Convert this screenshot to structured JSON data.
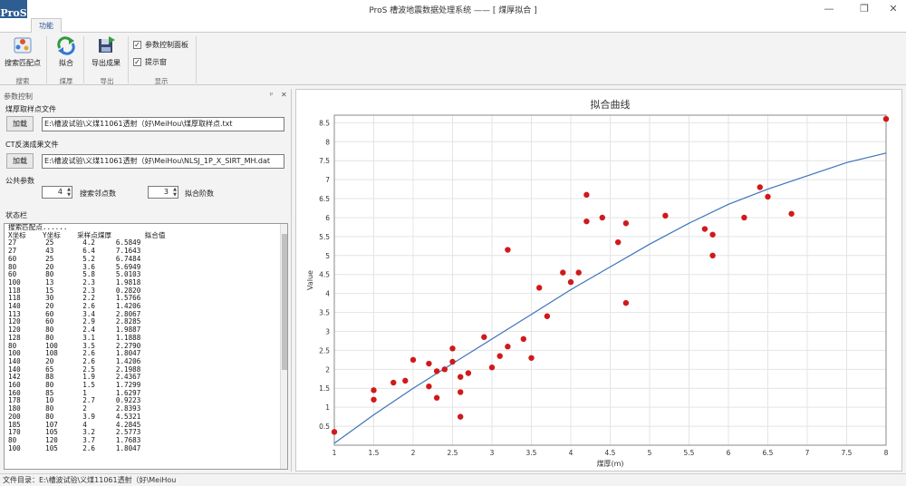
{
  "window": {
    "title": "ProS 槽波地震数据处理系统 —— [ 煤厚拟合 ]",
    "logo": "ProS",
    "controls": [
      "—",
      "❐",
      "✕"
    ]
  },
  "tabs": [
    {
      "label": "功能"
    }
  ],
  "ribbon": {
    "buttons": [
      {
        "label": "搜索匹配点",
        "icon": "search-match-icon"
      },
      {
        "label": "拟合",
        "icon": "fit-icon"
      },
      {
        "label": "导出成果",
        "icon": "export-icon"
      }
    ],
    "checkboxes": [
      {
        "label": "参数控制面板",
        "checked": true
      },
      {
        "label": "提示窗",
        "checked": true
      }
    ],
    "groups": [
      "搜索",
      "煤厚",
      "导出",
      "显示"
    ]
  },
  "panel": {
    "title": "参数控制",
    "pin": "ᵖ",
    "close": "✕",
    "sample_file_label": "煤厚取样点文件",
    "load_label": "加载",
    "sample_file_path": "E:\\槽波试验\\义煤11061透射（好\\MeiHou\\煤厚取样点.txt",
    "ct_file_label": "CT反演成果文件",
    "ct_file_path": "E:\\槽波试验\\义煤11061透射（好\\MeiHou\\NLSJ_1P_X_SIRT_MH.dat",
    "common_params_label": "公共参数",
    "search_count_value": "4",
    "search_count_label": "搜索邻点数",
    "fit_order_value": "3",
    "fit_order_label": "拟合阶数",
    "status_title": "状态栏",
    "status_lines": [
      "搜索匹配点......",
      "X坐标    Y坐标    采样点煤厚        拟合值",
      "27       25       4.2     6.5849",
      "27       43       6.4     7.1643",
      "60       25       5.2     6.7484",
      "80       20       3.6     5.6949",
      "60       80       5.8     5.0103",
      "100      13       2.3     1.9818",
      "118      15       2.3     0.2820",
      "118      30       2.2     1.5766",
      "140      20       2.6     1.4206",
      "113      60       3.4     2.8067",
      "120      60       2.9     2.8285",
      "120      80       2.4     1.9887",
      "128      80       3.1     1.1888",
      "80       100      3.5     2.2790",
      "100      108      2.6     1.8047",
      "140      20       2.6     1.4206",
      "140      65       2.5     2.1988",
      "142      88       1.9     2.4367",
      "160      80       1.5     1.7299",
      "160      85       1       1.6297",
      "178      10       2.7     0.9223",
      "180      80       2       2.8393",
      "200      80       3.9     4.5321",
      "185      107      4       4.2845",
      "170      105      3.2     2.5773",
      "80       120      3.7     1.7683",
      "100      105      2.6     1.8047"
    ]
  },
  "footer": {
    "path_text": "文件目录：E:\\槽波试验\\义煤11061透射（好\\MeiHou"
  },
  "colors": {
    "point": "#d0191b",
    "curve": "#3b74b8",
    "grid": "#e4e4e4",
    "logo_bg": "#2e5d92"
  },
  "chart_data": {
    "type": "scatter",
    "title": "拟合曲线",
    "xlabel": "煤厚(m)",
    "ylabel": "Value",
    "xlim": [
      1,
      8
    ],
    "ylim": [
      0,
      8.7
    ],
    "xticks": [
      1,
      1.5,
      2,
      2.5,
      3,
      3.5,
      4,
      4.5,
      5,
      5.5,
      6,
      6.5,
      7,
      7.5,
      8
    ],
    "xtick_labels": [
      "1",
      "1.5",
      "2",
      "2.5",
      "3",
      "3.5",
      "4",
      "4.5",
      "5",
      "5.5",
      "6",
      "6.5",
      "7",
      "7.5",
      "8"
    ],
    "yticks": [
      0.5,
      1,
      1.5,
      2,
      2.5,
      3,
      3.5,
      4,
      4.5,
      5,
      5.5,
      6,
      6.5,
      7,
      7.5,
      8,
      8.5
    ],
    "ytick_labels": [
      "0.5",
      "1",
      "1.5",
      "2",
      "2.5",
      "3",
      "3.5",
      "4",
      "4.5",
      "5",
      "5.5",
      "6",
      "6.5",
      "7",
      "7.5",
      "8",
      "8.5"
    ],
    "grid": true,
    "series": [
      {
        "type": "scatter",
        "points": [
          [
            1.0,
            0.35
          ],
          [
            1.5,
            1.45
          ],
          [
            1.5,
            1.2
          ],
          [
            1.75,
            1.65
          ],
          [
            1.9,
            1.7
          ],
          [
            2.0,
            2.25
          ],
          [
            2.2,
            2.15
          ],
          [
            2.2,
            1.55
          ],
          [
            2.3,
            1.95
          ],
          [
            2.3,
            1.25
          ],
          [
            2.4,
            2.0
          ],
          [
            2.5,
            2.55
          ],
          [
            2.5,
            2.2
          ],
          [
            2.6,
            1.8
          ],
          [
            2.6,
            1.4
          ],
          [
            2.6,
            0.75
          ],
          [
            2.7,
            1.9
          ],
          [
            2.9,
            2.85
          ],
          [
            3.0,
            2.05
          ],
          [
            3.1,
            2.35
          ],
          [
            3.2,
            2.6
          ],
          [
            3.2,
            5.15
          ],
          [
            3.4,
            2.8
          ],
          [
            3.5,
            2.3
          ],
          [
            3.6,
            4.15
          ],
          [
            3.7,
            3.4
          ],
          [
            3.9,
            4.55
          ],
          [
            4.0,
            4.3
          ],
          [
            4.1,
            4.55
          ],
          [
            4.2,
            6.6
          ],
          [
            4.2,
            5.9
          ],
          [
            4.4,
            6.0
          ],
          [
            4.6,
            5.35
          ],
          [
            4.7,
            5.85
          ],
          [
            4.7,
            3.75
          ],
          [
            5.2,
            6.05
          ],
          [
            5.7,
            5.7
          ],
          [
            5.8,
            5.55
          ],
          [
            5.8,
            5.0
          ],
          [
            6.2,
            6.0
          ],
          [
            6.4,
            6.8
          ],
          [
            6.5,
            6.55
          ],
          [
            6.8,
            6.1
          ],
          [
            8.0,
            8.6
          ]
        ]
      },
      {
        "type": "line",
        "points": [
          [
            1.0,
            0.05
          ],
          [
            1.5,
            0.8
          ],
          [
            2.0,
            1.5
          ],
          [
            2.5,
            2.15
          ],
          [
            3.0,
            2.8
          ],
          [
            3.5,
            3.45
          ],
          [
            4.0,
            4.1
          ],
          [
            4.5,
            4.7
          ],
          [
            5.0,
            5.3
          ],
          [
            5.5,
            5.85
          ],
          [
            6.0,
            6.35
          ],
          [
            6.5,
            6.75
          ],
          [
            7.0,
            7.1
          ],
          [
            7.5,
            7.45
          ],
          [
            8.0,
            7.7
          ]
        ]
      }
    ]
  }
}
